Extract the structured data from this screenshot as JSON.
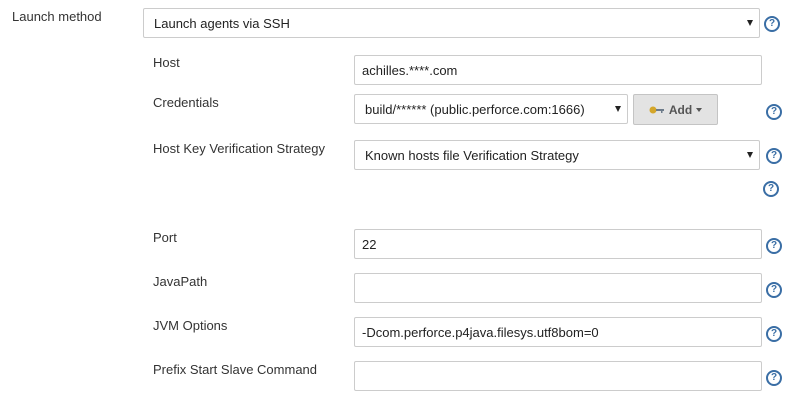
{
  "launch_method": {
    "label": "Launch method",
    "selected": "Launch agents via SSH"
  },
  "host": {
    "label": "Host",
    "value": "achilles.****.com"
  },
  "credentials": {
    "label": "Credentials",
    "selected": "build/****** (public.perforce.com:1666)",
    "add_label": "Add",
    "icon": "key-icon"
  },
  "host_key": {
    "label": "Host Key Verification Strategy",
    "selected": "Known hosts file Verification Strategy"
  },
  "port": {
    "label": "Port",
    "value": "22"
  },
  "java_path": {
    "label": "JavaPath",
    "value": ""
  },
  "jvm_options": {
    "label": "JVM Options",
    "value": "-Dcom.perforce.p4java.filesys.utf8bom=0"
  },
  "prefix_start": {
    "label": "Prefix Start Slave Command",
    "value": ""
  },
  "help_glyph": "?",
  "colors": {
    "help_icon": "#3a6ea5",
    "border": "#cccccc",
    "add_button_bg": "#e3e3e3",
    "key_icon": "#d4a62a"
  }
}
